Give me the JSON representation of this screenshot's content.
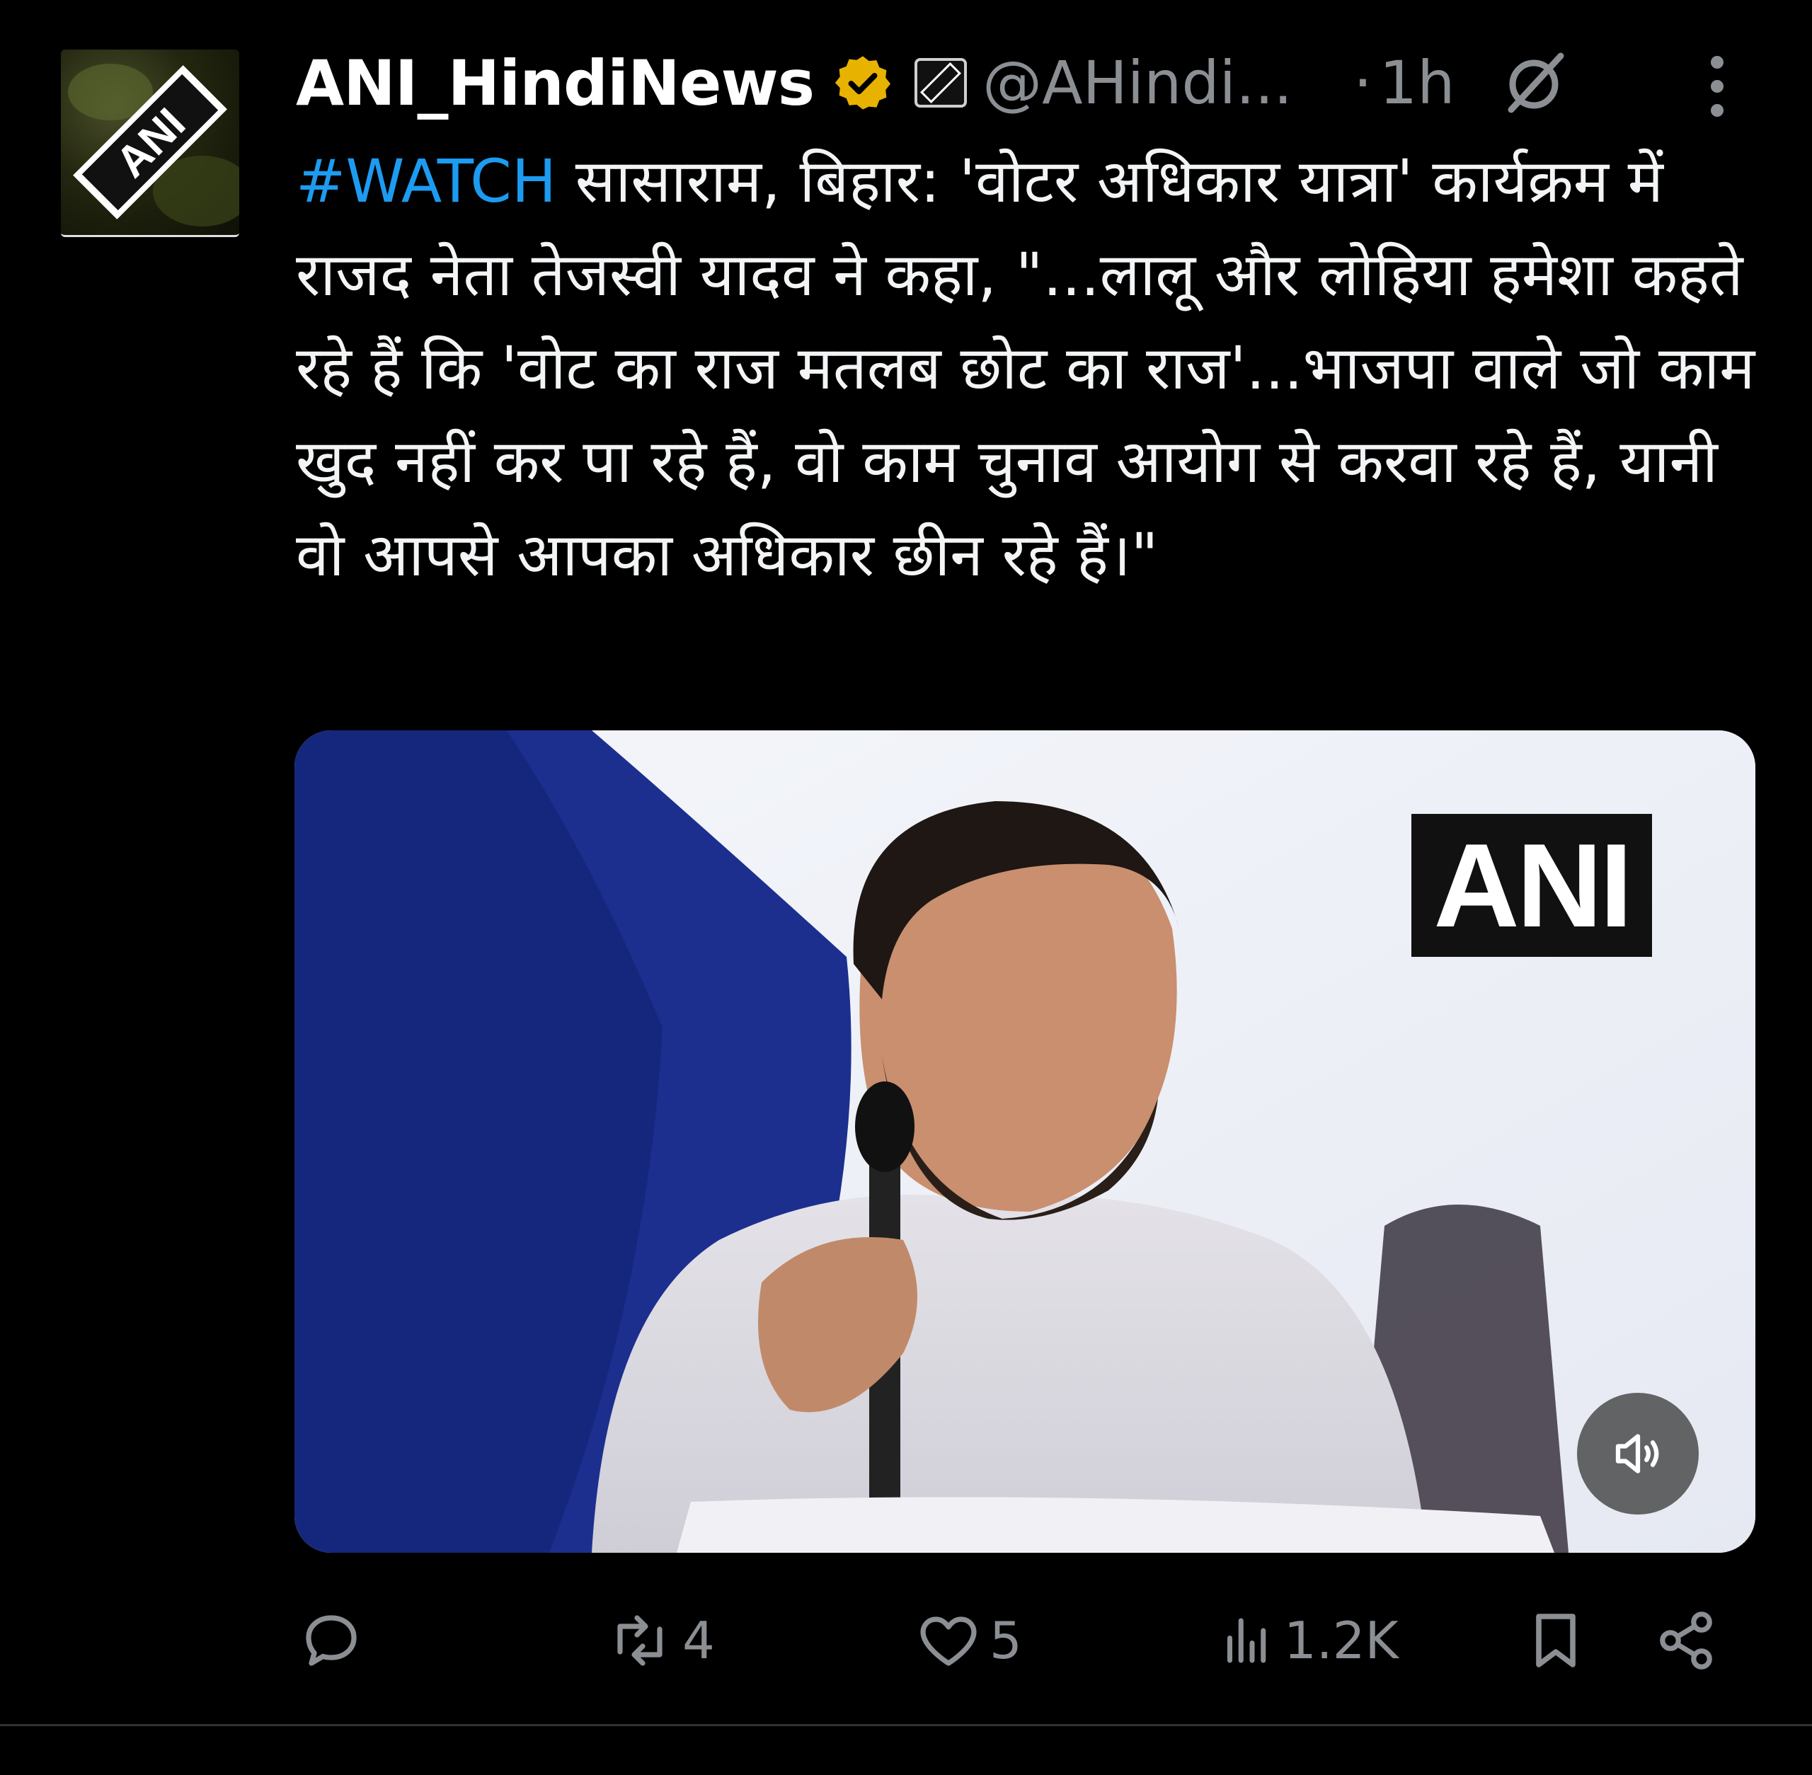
{
  "tweet": {
    "display_name": "ANI_HindiNews",
    "handle": "@AHindi...",
    "dot": "·",
    "time": "1h",
    "avatar_label": "ANI",
    "verified_color": "#e8b300",
    "text": {
      "hashtag": "#WATCH",
      "body": " सासाराम, बिहार: 'वोटर अधिकार यात्रा' कार्यक्रम में राजद नेता तेजस्वी यादव ने कहा, \"...लालू और लोहिया हमेशा कहते रहे हैं कि 'वोट का राज मतलब छोट का राज'...भाजपा वाले जो काम खुद नहीं कर पा रहे हैं, वो काम चुनाव आयोग से करवा रहे हैं, यानी वो आपसे आपका अधिकार छीन रहे हैं।\""
    },
    "media": {
      "watermark": "ANI",
      "mute_icon": "speaker-muted-icon"
    },
    "actions": {
      "reply": {
        "icon": "reply-icon",
        "count": ""
      },
      "retweet": {
        "icon": "retweet-icon",
        "count": "4"
      },
      "like": {
        "icon": "heart-icon",
        "count": "5"
      },
      "views": {
        "icon": "views-icon",
        "count": "1.2K"
      },
      "bookmark": {
        "icon": "bookmark-icon"
      },
      "share": {
        "icon": "share-icon"
      }
    }
  },
  "colors": {
    "background": "#000000",
    "text": "#e7e9ea",
    "muted": "#8b8f94",
    "link": "#1d9bf0"
  }
}
